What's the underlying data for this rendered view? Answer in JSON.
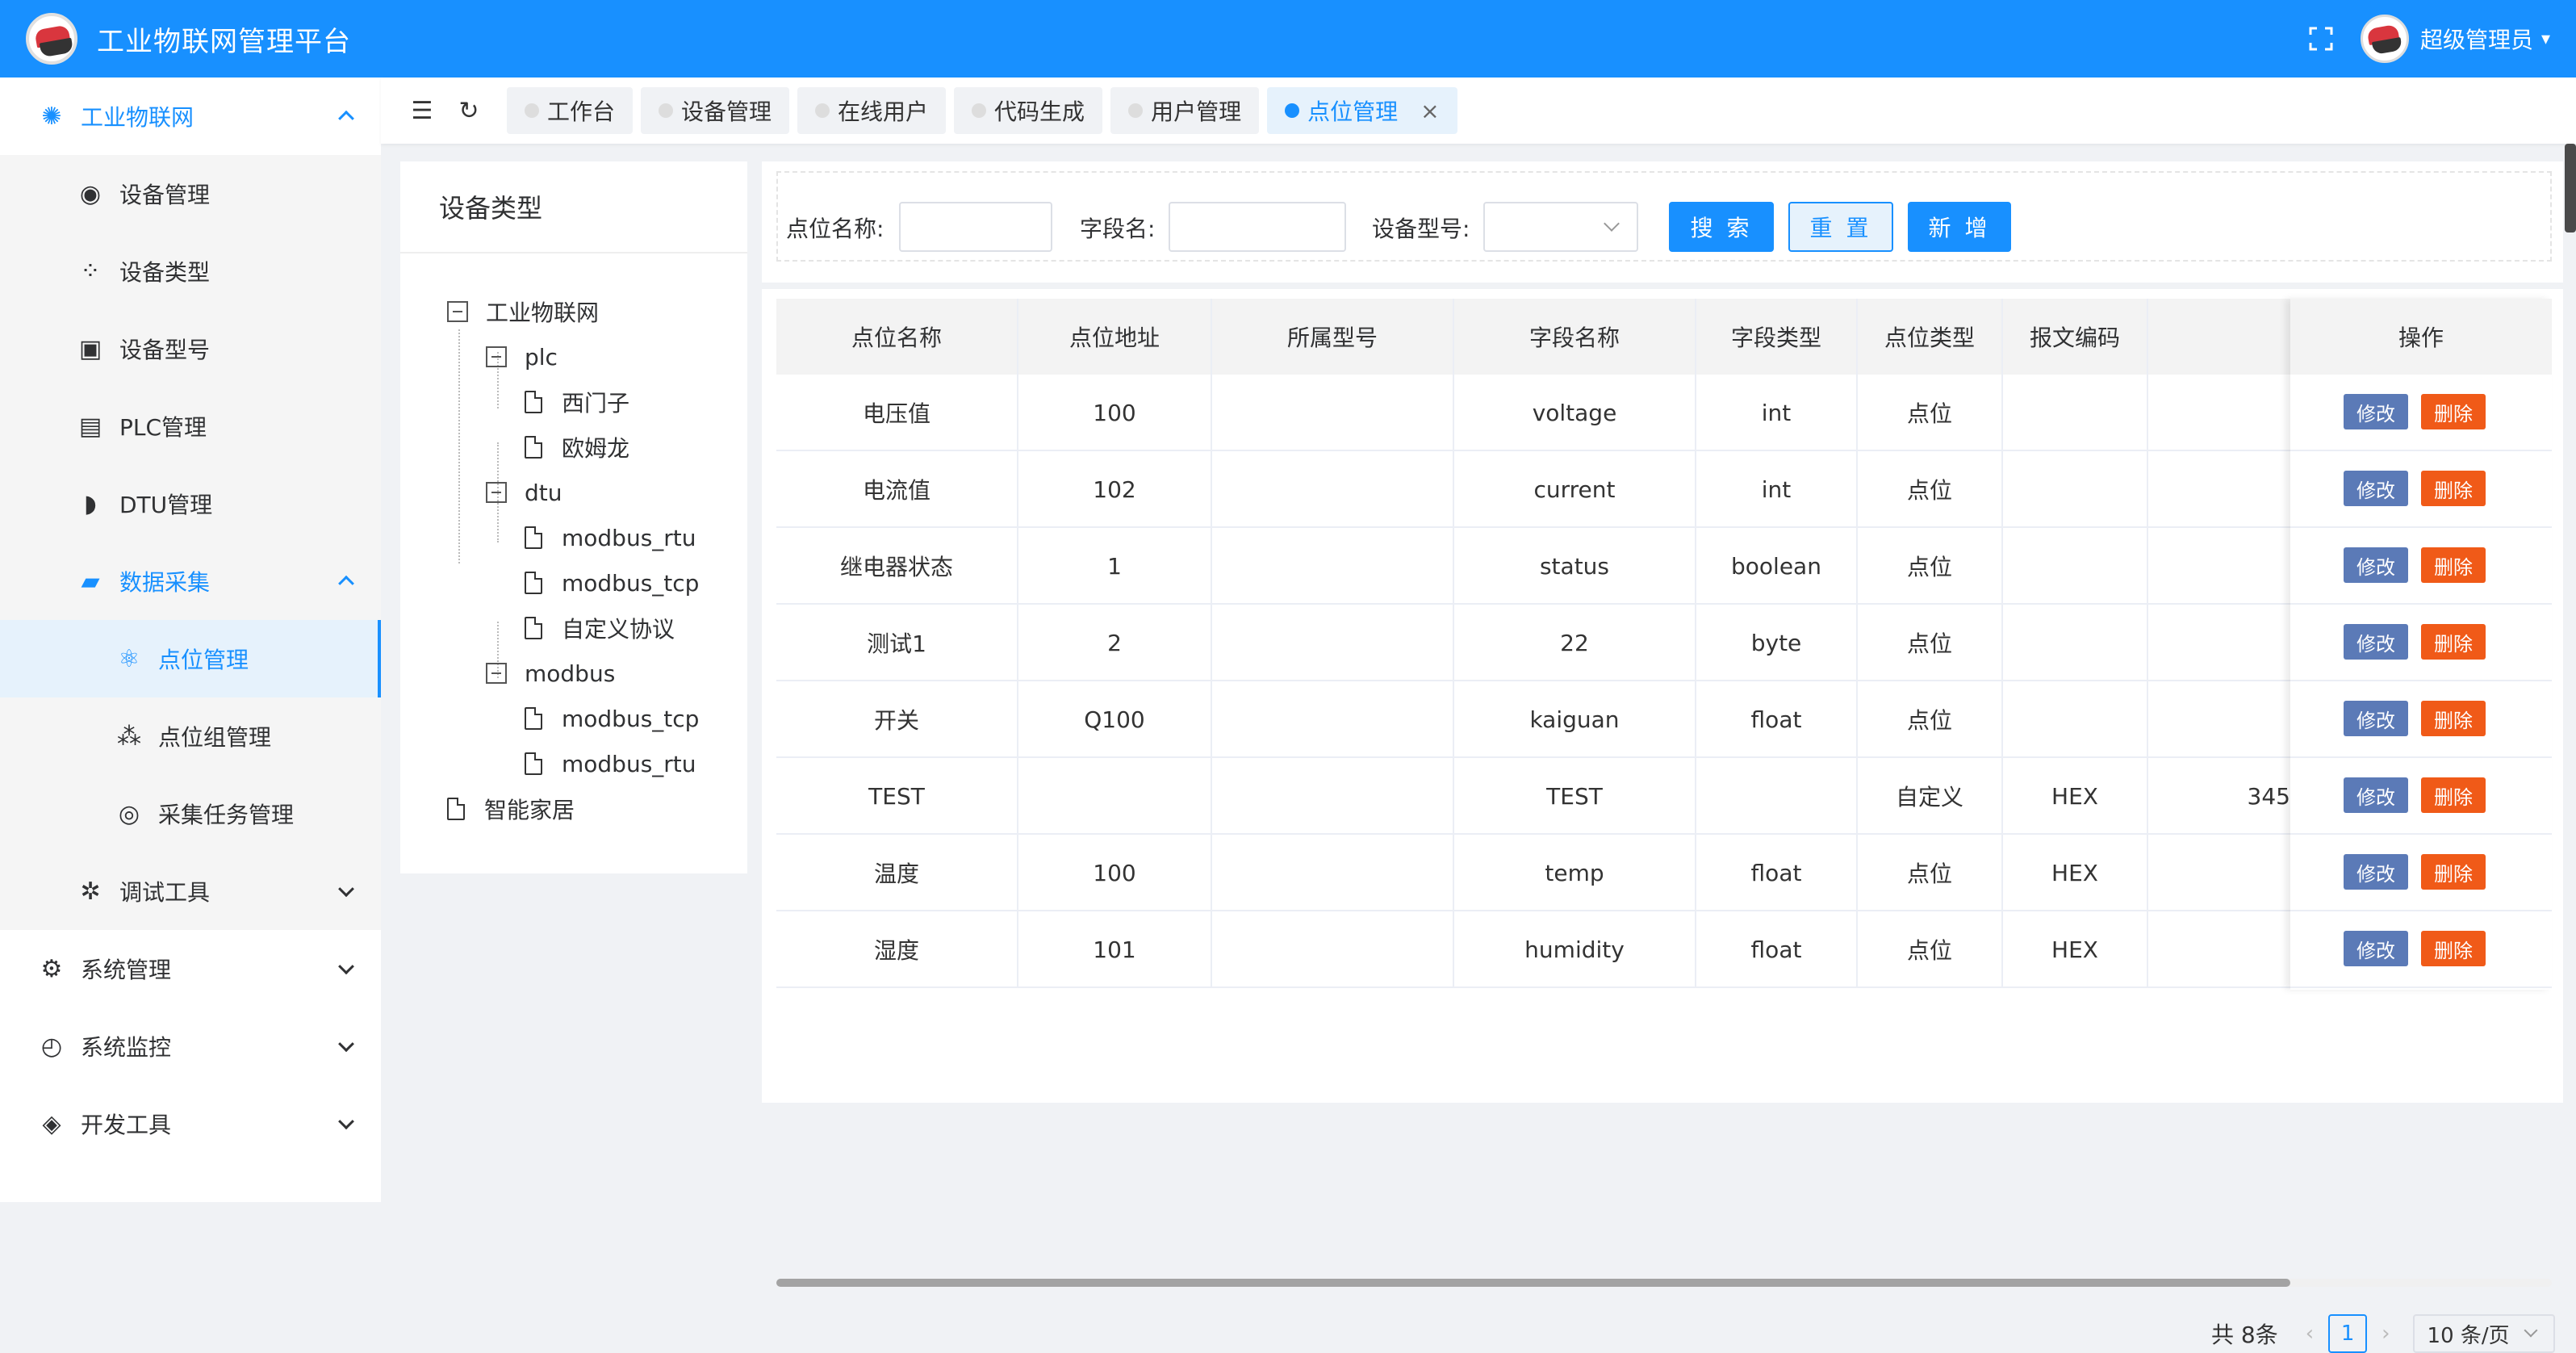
{
  "header": {
    "title": "工业物联网管理平台",
    "user": "超级管理员"
  },
  "sidebar": {
    "items": [
      {
        "label": "工业物联网",
        "icon": "iot-icon"
      },
      {
        "label": "设备管理",
        "icon": "device-icon"
      },
      {
        "label": "设备类型",
        "icon": "grid-icon"
      },
      {
        "label": "设备型号",
        "icon": "model-icon"
      },
      {
        "label": "PLC管理",
        "icon": "plc-icon"
      },
      {
        "label": "DTU管理",
        "icon": "dtu-icon"
      },
      {
        "label": "数据采集",
        "icon": "collect-icon"
      },
      {
        "label": "点位管理",
        "icon": "point-icon"
      },
      {
        "label": "点位组管理",
        "icon": "group-icon"
      },
      {
        "label": "采集任务管理",
        "icon": "task-icon"
      },
      {
        "label": "调试工具",
        "icon": "bug-icon"
      },
      {
        "label": "系统管理",
        "icon": "settings-icon"
      },
      {
        "label": "系统监控",
        "icon": "monitor-icon"
      },
      {
        "label": "开发工具",
        "icon": "code-icon"
      }
    ]
  },
  "tabs": [
    {
      "label": "工作台"
    },
    {
      "label": "设备管理"
    },
    {
      "label": "在线用户"
    },
    {
      "label": "代码生成"
    },
    {
      "label": "用户管理"
    },
    {
      "label": "点位管理"
    }
  ],
  "tree": {
    "title": "设备类型",
    "nodes": [
      {
        "label": "工业物联网"
      },
      {
        "label": "plc"
      },
      {
        "label": "西门子"
      },
      {
        "label": "欧姆龙"
      },
      {
        "label": "dtu"
      },
      {
        "label": "modbus_rtu"
      },
      {
        "label": "modbus_tcp"
      },
      {
        "label": "自定义协议"
      },
      {
        "label": "modbus"
      },
      {
        "label": "modbus_tcp"
      },
      {
        "label": "modbus_rtu"
      },
      {
        "label": "智能家居"
      }
    ]
  },
  "search": {
    "point_name_label": "点位名称:",
    "field_name_label": "字段名:",
    "device_model_label": "设备型号:",
    "search_btn": "搜 索",
    "reset_btn": "重 置",
    "add_btn": "新 增"
  },
  "table": {
    "columns": [
      "点位名称",
      "点位地址",
      "所属型号",
      "字段名称",
      "字段类型",
      "点位类型",
      "报文编码",
      "",
      "操作"
    ],
    "rows": [
      {
        "name": "电压值",
        "addr": "100",
        "model": "",
        "field": "voltage",
        "ftype": "int",
        "ptype": "点位",
        "enc": "",
        "extra": ""
      },
      {
        "name": "电流值",
        "addr": "102",
        "model": "",
        "field": "current",
        "ftype": "int",
        "ptype": "点位",
        "enc": "",
        "extra": ""
      },
      {
        "name": "继电器状态",
        "addr": "1",
        "model": "",
        "field": "status",
        "ftype": "boolean",
        "ptype": "点位",
        "enc": "",
        "extra": ""
      },
      {
        "name": "测试1",
        "addr": "2",
        "model": "",
        "field": "22",
        "ftype": "byte",
        "ptype": "点位",
        "enc": "",
        "extra": ""
      },
      {
        "name": "开关",
        "addr": "Q100",
        "model": "",
        "field": "kaiguan",
        "ftype": "float",
        "ptype": "点位",
        "enc": "",
        "extra": ""
      },
      {
        "name": "TEST",
        "addr": "",
        "model": "",
        "field": "TEST",
        "ftype": "",
        "ptype": "自定义",
        "enc": "HEX",
        "extra": "345"
      },
      {
        "name": "温度",
        "addr": "100",
        "model": "",
        "field": "temp",
        "ftype": "float",
        "ptype": "点位",
        "enc": "HEX",
        "extra": ""
      },
      {
        "name": "湿度",
        "addr": "101",
        "model": "",
        "field": "humidity",
        "ftype": "float",
        "ptype": "点位",
        "enc": "HEX",
        "extra": ""
      }
    ],
    "edit_label": "修改",
    "delete_label": "删除"
  },
  "pagination": {
    "total": "共 8条",
    "current": "1",
    "page_size": "10 条/页"
  },
  "colors": {
    "primary": "#1890ff",
    "edit": "#5b7ab7",
    "delete": "#f05a18"
  }
}
